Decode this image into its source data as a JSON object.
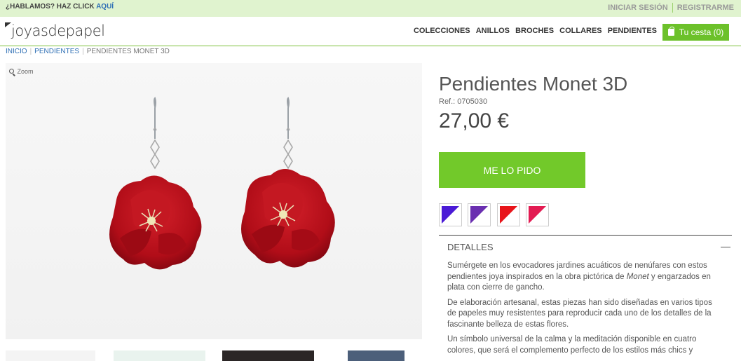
{
  "topbar": {
    "hablamos_prefix": "¿HABLAMOS? HAZ CLICK",
    "hablamos_link": "AQUÍ",
    "login": "INICIAR SESIÓN",
    "register": "REGISTRARME"
  },
  "header": {
    "logo": "joyasdepapel",
    "nav": [
      "COLECCIONES",
      "ANILLOS",
      "BROCHES",
      "COLLARES",
      "PENDIENTES"
    ],
    "cart": "Tu cesta (0)"
  },
  "breadcrumb": [
    "INICIO",
    "PENDIENTES",
    "PENDIENTES MONET 3D"
  ],
  "gallery": {
    "zoom": "Zoom"
  },
  "product": {
    "title": "Pendientes Monet 3D",
    "ref": "Ref.: 0705030",
    "price": "27,00 €",
    "buy": "ME LO PIDO",
    "swatch_colors": [
      "#4a1ad6",
      "#6a2fb0",
      "#e8141a",
      "#e31b52"
    ]
  },
  "details": {
    "heading": "DETALLES",
    "p1_pre": "Sumérgete en los evocadores jardines acuáticos de nenúfares con estos pendientes joya inspirados en la obra pictórica de ",
    "p1_em": "Monet",
    "p1_post": " y engarzados en plata con cierre de gancho.",
    "p2": "De elaboración artesanal, estas piezas han sido diseñadas en varios tipos de papeles muy resistentes para reproducir cada uno de los detalles de la fascinante belleza de estas flores.",
    "p3": "Un símbolo universal de la calma y la meditación disponible en cuatro colores, que será el complemento perfecto de los estilos más chics y"
  }
}
